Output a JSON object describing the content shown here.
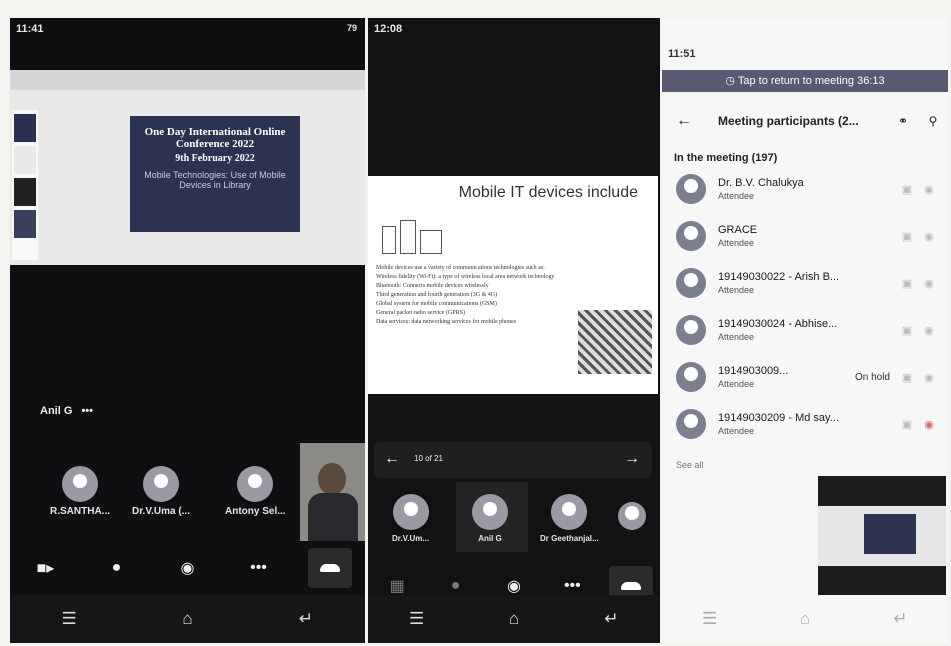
{
  "panel1": {
    "status_time": "11:41",
    "status_right": "79",
    "slide_title": "One Day International Online Conference 2022",
    "slide_date": "9th February 2022",
    "slide_sub": "Mobile Technologies: Use of Mobile Devices in Library",
    "presenter": "Anil G",
    "more": "•••",
    "participants": [
      {
        "name": "R.SANTHA..."
      },
      {
        "name": "Dr.V.Uma (..."
      },
      {
        "name": "Antony Sel..."
      }
    ]
  },
  "panel2": {
    "status_time": "12:08",
    "slide_title": "Mobile IT devices include",
    "slide_body": [
      "Mobile devices use a variety of communications technologies such as:",
      "Wireless fidelity (Wi-Fi): a type of wireless local area network technology",
      "Bluetooth: Connects mobile devices wirelessly",
      "Third generation and fourth generation (3G & 4G)",
      "Global system for mobile communications (GSM)",
      "General packet radio service (GPRS)",
      "Data services: data networking services for mobile phones"
    ],
    "pager": "10 of 21",
    "participants": [
      {
        "name": "Dr.V.Um..."
      },
      {
        "name": "Anil G"
      },
      {
        "name": "Dr Geethanjal..."
      }
    ]
  },
  "panel3": {
    "status_time": "11:51",
    "banner": "Tap to return to meeting 36:13",
    "title": "Meeting participants (2...",
    "section": "In the meeting (197)",
    "participants": [
      {
        "name": "Dr. B.V. Chalukya",
        "role": "Attendee",
        "note": ""
      },
      {
        "name": "GRACE",
        "role": "Attendee",
        "note": ""
      },
      {
        "name": "19149030022 - Arish B...",
        "role": "Attendee",
        "note": ""
      },
      {
        "name": "19149030024 - Abhise...",
        "role": "Attendee",
        "note": ""
      },
      {
        "name": "1914903009...",
        "role": "Attendee",
        "note": "On hold"
      },
      {
        "name": "19149030209 - Md say...",
        "role": "Attendee",
        "note": ""
      }
    ],
    "see_all": "See all"
  }
}
